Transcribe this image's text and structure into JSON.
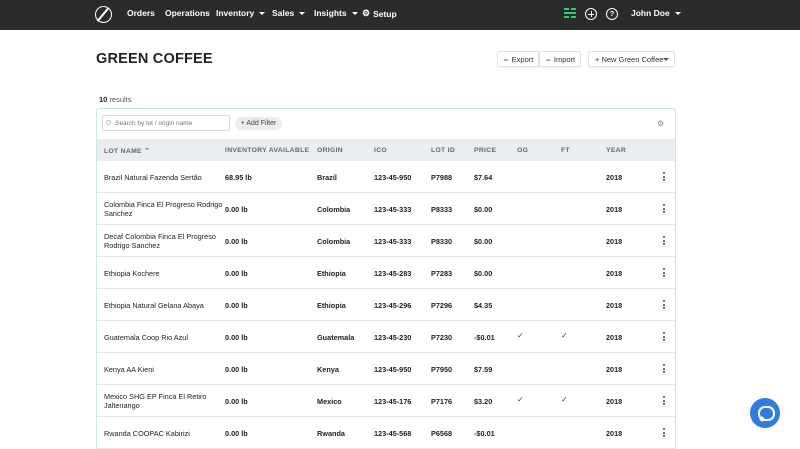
{
  "nav": {
    "items": [
      {
        "label": "Orders",
        "caret": false
      },
      {
        "label": "Operations",
        "caret": false
      },
      {
        "label": "Inventory",
        "caret": true
      },
      {
        "label": "Sales",
        "caret": true
      },
      {
        "label": "Insights",
        "caret": true
      },
      {
        "label": "Setup",
        "caret": false
      }
    ],
    "help_glyph": "?",
    "user_name": "John Doe",
    "accent_color": "#2ecc71"
  },
  "header": {
    "title": "GREEN COFFEE",
    "export_label": "Export",
    "import_label": "Import",
    "new_label": "+ New Green Coffee"
  },
  "results": {
    "count": "10",
    "suffix": "results"
  },
  "filters": {
    "search_placeholder": "Search by lot / origin name",
    "add_filter_label": "+ Add Filter"
  },
  "table": {
    "columns": [
      "LOT NAME ⌃",
      "INVENTORY AVAILABLE",
      "ORIGIN",
      "ICO",
      "LOT ID",
      "PRICE",
      "OG",
      "FT",
      "YEAR"
    ],
    "rows": [
      {
        "name": "Brazil Natural Fazenda Sertão",
        "inventory": "68.95 lb",
        "origin": "Brazil",
        "ico": "123-45-950",
        "lot_id": "P7988",
        "price": "$7.64",
        "og": false,
        "ft": false,
        "year": "2018"
      },
      {
        "name": "Colombia Finca El Progreso Rodrigo Sanchez",
        "inventory": "0.00 lb",
        "origin": "Colombia",
        "ico": "123-45-333",
        "lot_id": "P8333",
        "price": "$0.00",
        "og": false,
        "ft": false,
        "year": "2018"
      },
      {
        "name": "Decaf Colombia Finca El Progreso Rodrigo Sanchez",
        "inventory": "0.00 lb",
        "origin": "Colombia",
        "ico": "123-45-333",
        "lot_id": "P8330",
        "price": "$0.00",
        "og": false,
        "ft": false,
        "year": "2018"
      },
      {
        "name": "Ethiopia Kochere",
        "inventory": "0.00 lb",
        "origin": "Ethiopia",
        "ico": "123-45-283",
        "lot_id": "P7283",
        "price": "$0.00",
        "og": false,
        "ft": false,
        "year": "2018"
      },
      {
        "name": "Ethiopia Natural Gelana Abaya",
        "inventory": "0.00 lb",
        "origin": "Ethiopia",
        "ico": "123-45-296",
        "lot_id": "P7296",
        "price": "$4.35",
        "og": false,
        "ft": false,
        "year": "2018"
      },
      {
        "name": "Guatemala Coop Rio Azul",
        "inventory": "0.00 lb",
        "origin": "Guatemala",
        "ico": "123-45-230",
        "lot_id": "P7230",
        "price": "-$0.01",
        "og": true,
        "ft": true,
        "year": "2018"
      },
      {
        "name": "Kenya AA Kieni",
        "inventory": "0.00 lb",
        "origin": "Kenya",
        "ico": "123-45-950",
        "lot_id": "P7950",
        "price": "$7.59",
        "og": false,
        "ft": false,
        "year": "2018"
      },
      {
        "name": "Mexico SHG EP Finca El Retiro Jaltenango",
        "inventory": "0.00 lb",
        "origin": "Mexico",
        "ico": "123-45-176",
        "lot_id": "P7176",
        "price": "$3.20",
        "og": true,
        "ft": true,
        "year": "2018"
      },
      {
        "name": "Rwanda COOPAC Kabirizi",
        "inventory": "0.00 lb",
        "origin": "Rwanda",
        "ico": "123-45-568",
        "lot_id": "P6568",
        "price": "-$0.01",
        "og": false,
        "ft": false,
        "year": "2018"
      }
    ]
  },
  "icons": {
    "check": "✓",
    "chat": "chat-icon"
  }
}
